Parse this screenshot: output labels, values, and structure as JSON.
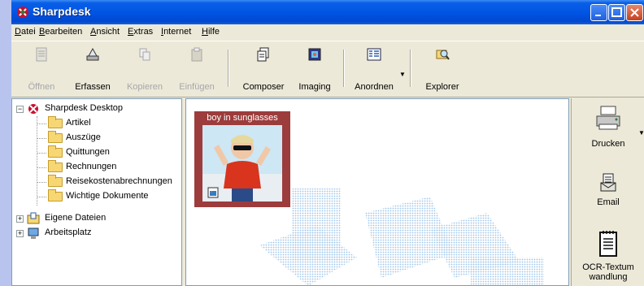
{
  "window": {
    "title": "Sharpdesk"
  },
  "menu": [
    "Datei",
    "Bearbeiten",
    "Ansicht",
    "Extras",
    "Internet",
    "Hilfe"
  ],
  "toolbar": {
    "open": "Öffnen",
    "capture": "Erfassen",
    "copy": "Kopieren",
    "paste": "Einfügen",
    "composer": "Composer",
    "imaging": "Imaging",
    "arrange": "Anordnen",
    "explorer": "Explorer"
  },
  "tree": {
    "root": "Sharpdesk Desktop",
    "folders": [
      "Artikel",
      "Auszüge",
      "Quittungen",
      "Rechnungen",
      "Reisekostenabrechnungen",
      "Wichtige Dokumente"
    ],
    "my_files": "Eigene Dateien",
    "workstation": "Arbeitsplatz"
  },
  "main": {
    "thumbnail_title": "boy in sunglasses"
  },
  "right_panel": {
    "print": "Drucken",
    "email": "Email",
    "ocr_line1": "OCR-Textum",
    "ocr_line2": "wandlung"
  },
  "colors": {
    "title_bar": "#0055e5",
    "thumbnail_frame": "#9c3c3c",
    "tree_folder": "#f7d774"
  }
}
